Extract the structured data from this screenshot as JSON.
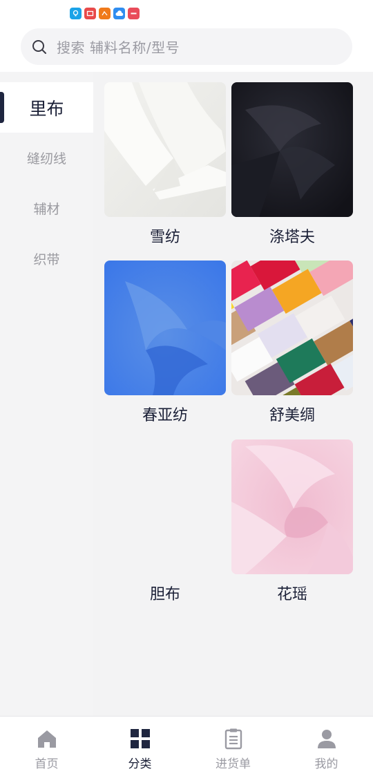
{
  "search": {
    "placeholder": "搜索 辅料名称/型号"
  },
  "sidebar": {
    "items": [
      {
        "label": "里布",
        "active": true
      },
      {
        "label": "缝纫线",
        "active": false
      },
      {
        "label": "辅材",
        "active": false
      },
      {
        "label": "织带",
        "active": false
      }
    ]
  },
  "products": [
    {
      "name": "雪纺"
    },
    {
      "name": "涤塔夫"
    },
    {
      "name": "春亚纺"
    },
    {
      "name": "舒美绸"
    },
    {
      "name": "胆布"
    },
    {
      "name": "花瑶"
    }
  ],
  "nav": {
    "items": [
      {
        "label": "首页",
        "icon": "home-icon"
      },
      {
        "label": "分类",
        "icon": "grid-icon",
        "active": true
      },
      {
        "label": "进货单",
        "icon": "clipboard-icon"
      },
      {
        "label": "我的",
        "icon": "user-icon"
      }
    ]
  },
  "colors": {
    "accent": "#1f2640",
    "inactive": "#9a9aa2",
    "sidebar_bg": "#f4f4f5"
  }
}
